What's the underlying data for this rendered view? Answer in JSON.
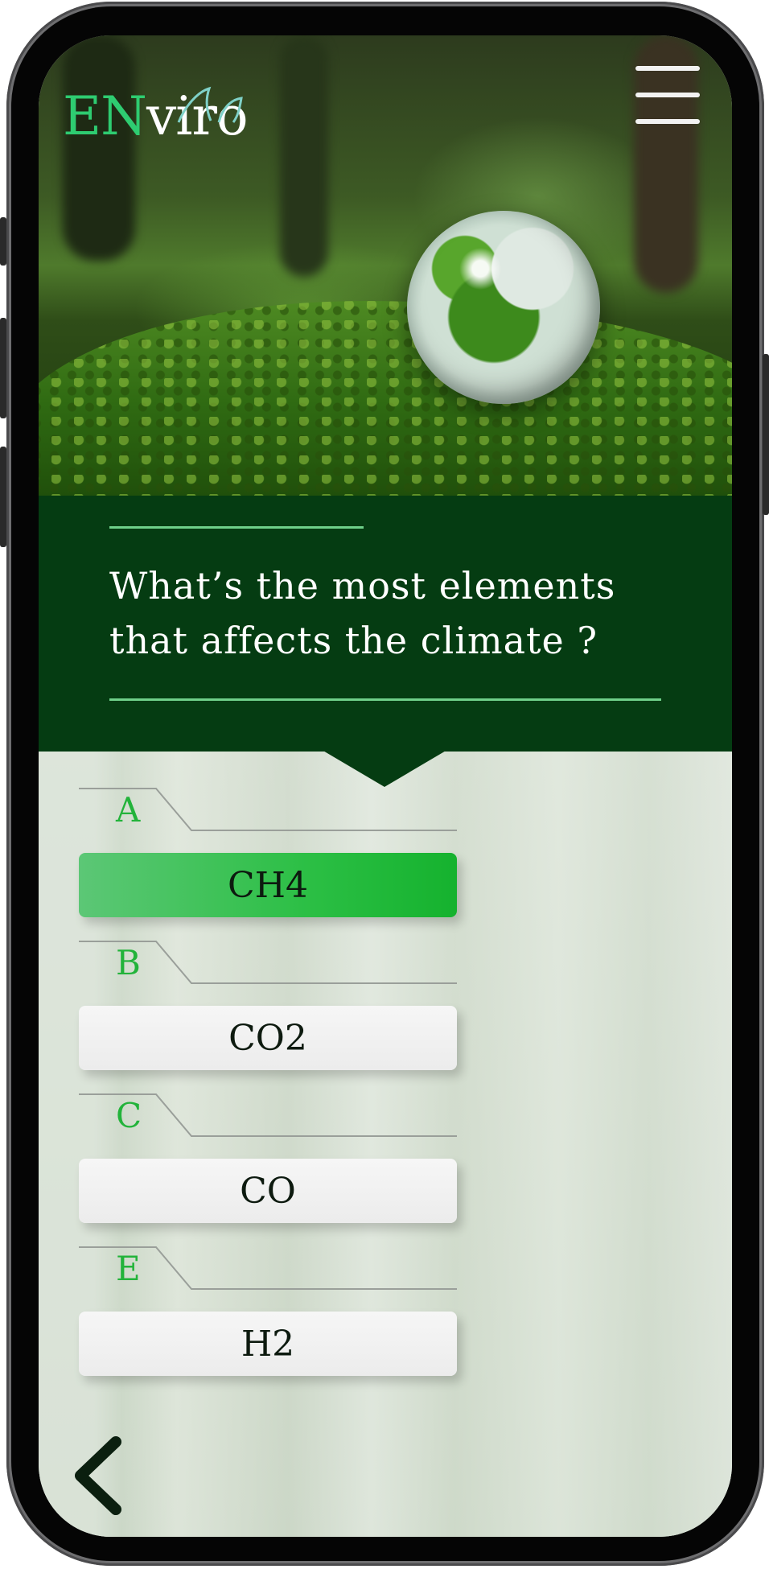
{
  "app": {
    "logo_prefix": "EN",
    "logo_suffix": "viro"
  },
  "colors": {
    "brand_green": "#2ecc71",
    "panel_dark_green": "#053c12",
    "selected_green": "#2cbf45",
    "letter_green": "#22b33a"
  },
  "icons": {
    "menu": "hamburger-menu-icon",
    "back": "chevron-left-icon",
    "logo_leaf": "leaf-icon"
  },
  "question": {
    "line1": "What’s the most elements",
    "line2": "that affects the climate ?"
  },
  "options": [
    {
      "letter": "A",
      "label": "CH4",
      "selected": true
    },
    {
      "letter": "B",
      "label": "CO2",
      "selected": false
    },
    {
      "letter": "C",
      "label": "CO",
      "selected": false
    },
    {
      "letter": "E",
      "label": "H2",
      "selected": false
    }
  ]
}
